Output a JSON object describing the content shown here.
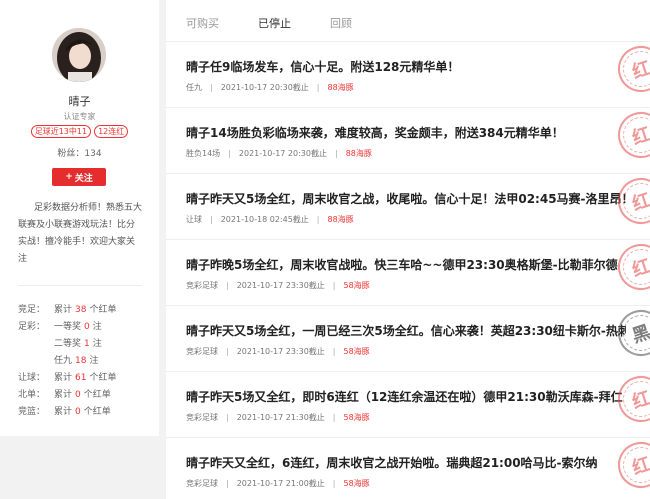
{
  "profile": {
    "name": "晴子",
    "cert": "认证专家",
    "tags": [
      "足球近13中11",
      "12连红"
    ],
    "fans": "粉丝：134",
    "follow_label": "关注",
    "bio": "足彩数据分析师！熟悉五大联赛及小联赛游戏玩法！比分实战！擅冷能手！欢迎大家关注",
    "stats": [
      {
        "label": "竞足：",
        "text_pre": "累计",
        "num": "38",
        "text_post": "个红单"
      },
      {
        "label": "足彩：",
        "text_pre": "一等奖",
        "num": "0",
        "text_post": "注"
      },
      {
        "label": "",
        "text_pre": "二等奖",
        "num": "1",
        "text_post": "注"
      },
      {
        "label": "",
        "text_pre": "任九",
        "num": "18",
        "text_post": "注"
      },
      {
        "label": "让球：",
        "text_pre": "累计",
        "num": "61",
        "text_post": "个红单"
      },
      {
        "label": "北单：",
        "text_pre": "累计",
        "num": "0",
        "text_post": "个红单"
      },
      {
        "label": "竞篮：",
        "text_pre": "累计",
        "num": "0",
        "text_post": "个红单"
      }
    ]
  },
  "tabs": [
    "可购买",
    "已停止",
    "回顾"
  ],
  "active_tab": 1,
  "items": [
    {
      "title": "晴子任9临场发车，信心十足。附送128元精华单！",
      "category": "任九",
      "time": "2021-10-17 20:30截止",
      "price": "88海豚",
      "stamp": "红",
      "stamp_color": "red"
    },
    {
      "title": "晴子14场胜负彩临场来袭，难度较高，奖金颇丰，附送384元精华单！",
      "category": "胜负14场",
      "time": "2021-10-17 20:30截止",
      "price": "88海豚",
      "stamp": "红",
      "stamp_color": "red"
    },
    {
      "title": "晴子昨天又5场全红，周末收官之战，收尾啦。信心十足！法甲02:45马赛-洛里昂！",
      "category": "让球",
      "time": "2021-10-18 02:45截止",
      "price": "88海豚",
      "stamp": "红",
      "stamp_color": "red"
    },
    {
      "title": "晴子昨晚5场全红，周末收官战啦。快三车哈~~德甲23:30奥格斯堡-比勒菲尔德",
      "category": "竞彩足球",
      "time": "2021-10-17 23:30截止",
      "price": "58海豚",
      "stamp": "红",
      "stamp_color": "red"
    },
    {
      "title": "晴子昨天又5场全红，一周已经三次5场全红。信心来袭！英超23:30纽卡斯尔-热刺",
      "category": "竞彩足球",
      "time": "2021-10-17 23:30截止",
      "price": "58海豚",
      "stamp": "黑",
      "stamp_color": "grey"
    },
    {
      "title": "晴子昨天5场又全红，即时6连红（12连红余温还在啦）德甲21:30勒沃库森-拜仁",
      "category": "竞彩足球",
      "time": "2021-10-17 21:30截止",
      "price": "58海豚",
      "stamp": "红",
      "stamp_color": "red"
    },
    {
      "title": "晴子昨天又全红，6连红，周末收官之战开始啦。瑞典超21:00哈马比-索尔纳",
      "category": "竞彩足球",
      "time": "2021-10-17 21:00截止",
      "price": "58海豚",
      "stamp": "红",
      "stamp_color": "red"
    }
  ]
}
